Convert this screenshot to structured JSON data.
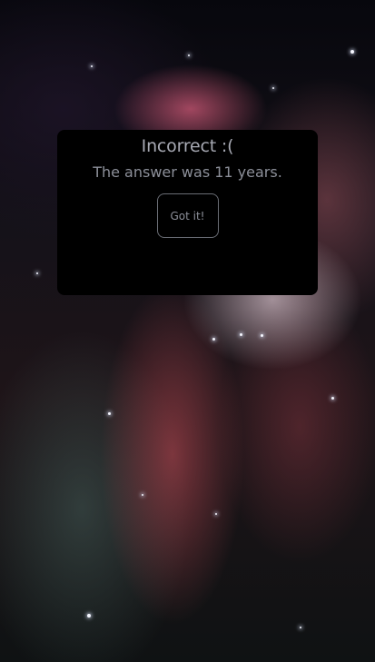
{
  "background": {
    "icon": "nebula-background"
  },
  "dialog": {
    "title": "Incorrect :(",
    "message": "The answer was 11 years.",
    "button_label": "Got it!"
  },
  "colors": {
    "dialog_background": "#000000",
    "dialog_text": "#8c8f99",
    "button_border": "#6a6d75"
  }
}
